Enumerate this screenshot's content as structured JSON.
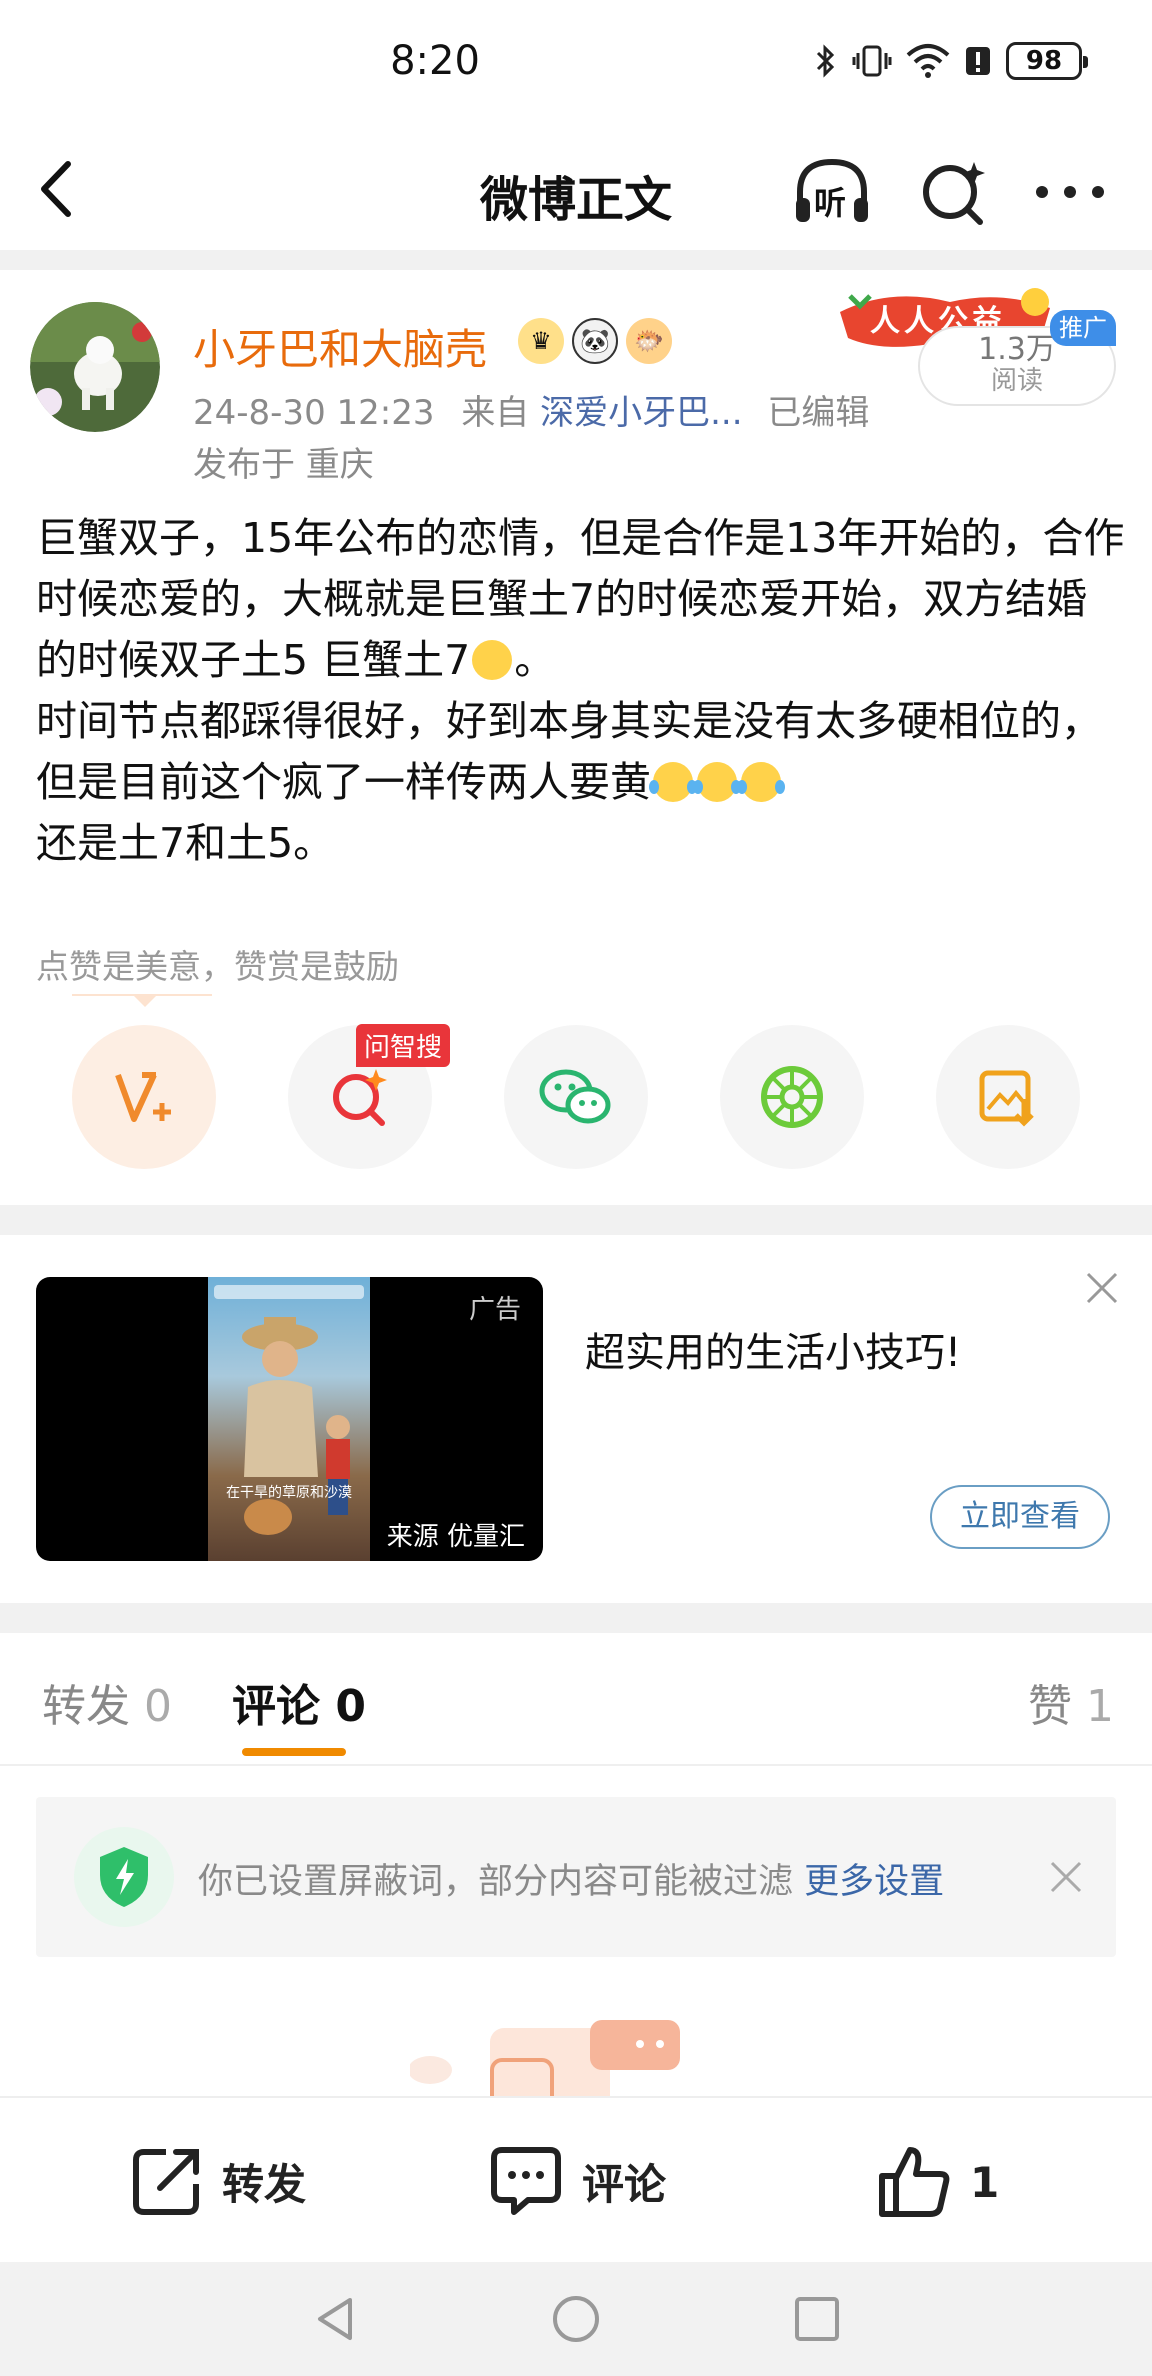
{
  "status": {
    "time": "8:20",
    "battery": "98"
  },
  "header": {
    "title": "微博正文",
    "listen_label": "听"
  },
  "post": {
    "username": "小牙巴和大脑壳",
    "date": "24-8-30 12:23",
    "source_prefix": "来自",
    "source": "深爱小牙巴...",
    "edited": "已编辑",
    "location": "发布于 重庆",
    "promo_banner": "人人公益",
    "read_count": "1.3万",
    "read_label": "阅读",
    "promo_tag": "推广",
    "body": {
      "p1": "巨蟹双子，15年公布的恋情，但是合作是13年开始的，合作时候恋爱的，大概就是巨蟹土7的时候恋爱开始，双方结婚的时候双子土5 巨蟹土7",
      "p1_end": "。",
      "p2": "时间节点都踩得很好，好到本身其实是没有太多硬相位的，但是目前这个疯了一样传两人要黄",
      "p3": "还是土7和土5。"
    },
    "like_hint": "点赞是美意，赞赏是鼓励",
    "ask_tag": "问智搜"
  },
  "ad": {
    "mark": "广告",
    "source": "来源 优量汇",
    "caption": "在干旱的草原和沙漠",
    "title": "超实用的生活小技巧!",
    "button": "立即查看"
  },
  "tabs": {
    "repost": "转发",
    "repost_count": "0",
    "comment": "评论",
    "comment_count": "0",
    "like": "赞",
    "like_count": "1"
  },
  "filter": {
    "text": "你已设置屏蔽词，部分内容可能被过滤",
    "link": "更多设置"
  },
  "bottom": {
    "repost": "转发",
    "comment": "评论",
    "like_count": "1"
  },
  "colors": {
    "accent_orange": "#f08a00",
    "username": "#e86b0c",
    "link_blue": "#3b67a8"
  }
}
